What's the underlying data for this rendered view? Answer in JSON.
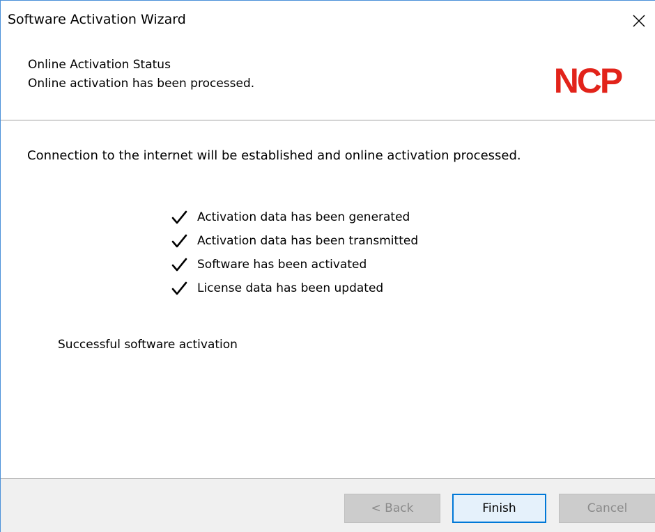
{
  "window": {
    "title": "Software Activation Wizard",
    "close_icon": "close-icon"
  },
  "header": {
    "title": "Online Activation Status",
    "subtitle": "Online activation has been processed.",
    "logo_text": "NCP",
    "logo_color": "#e2231a"
  },
  "content": {
    "intro": "Connection to the internet will be established and online activation processed.",
    "steps": [
      {
        "icon": "checkmark-icon",
        "label": "Activation data has been generated"
      },
      {
        "icon": "checkmark-icon",
        "label": "Activation data has been transmitted"
      },
      {
        "icon": "checkmark-icon",
        "label": "Software has been activated"
      },
      {
        "icon": "checkmark-icon",
        "label": "License data has been updated"
      }
    ],
    "status": "Successful software activation"
  },
  "footer": {
    "back_label": "< Back",
    "back_enabled": false,
    "finish_label": "Finish",
    "finish_enabled": true,
    "cancel_label": "Cancel",
    "cancel_enabled": false,
    "accent_color": "#0078d7"
  }
}
